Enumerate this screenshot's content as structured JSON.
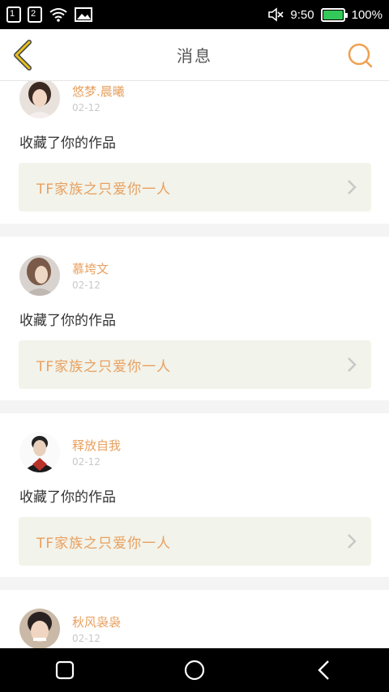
{
  "status": {
    "time": "9:50",
    "battery": "100%",
    "sim1": "1",
    "sim2": "2"
  },
  "header": {
    "title": "消息"
  },
  "messages": [
    {
      "user": "悠梦.晨曦",
      "date": "02-12",
      "action": "收藏了你的作品",
      "work": "TF家族之只爱你一人"
    },
    {
      "user": "慕垮文",
      "date": "02-12",
      "action": "收藏了你的作品",
      "work": "TF家族之只爱你一人"
    },
    {
      "user": "释放自我",
      "date": "02-12",
      "action": "收藏了你的作品",
      "work": "TF家族之只爱你一人"
    },
    {
      "user": "秋风袅袅",
      "date": "02-12"
    }
  ],
  "colors": {
    "accent": "#e8a060",
    "back": "#e6c020",
    "link_bg": "#f2f3ea"
  }
}
